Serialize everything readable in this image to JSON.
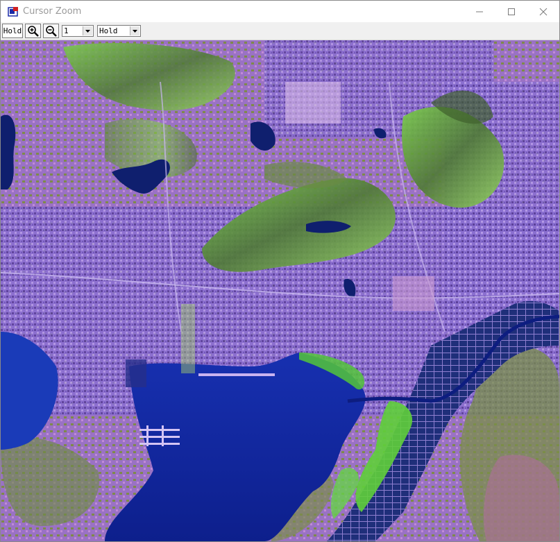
{
  "window": {
    "title": "Cursor Zoom",
    "app_icon": "envi-app-icon"
  },
  "controls": {
    "minimize_icon": "minimize-icon",
    "maximize_icon": "maximize-icon",
    "close_icon": "close-icon"
  },
  "toolbar": {
    "hold_label": "Hold",
    "zoom_in_icon": "zoom-in-icon",
    "zoom_out_icon": "zoom-out-icon",
    "zoom_factor": "1",
    "mode": "Hold"
  },
  "image": {
    "description_icon": "satellite-image",
    "colors": {
      "urban": "#8a6fd0",
      "vegetation": "#6fcf3f",
      "water": "#1a2aa8",
      "mountain": "#5c7a3a"
    }
  }
}
